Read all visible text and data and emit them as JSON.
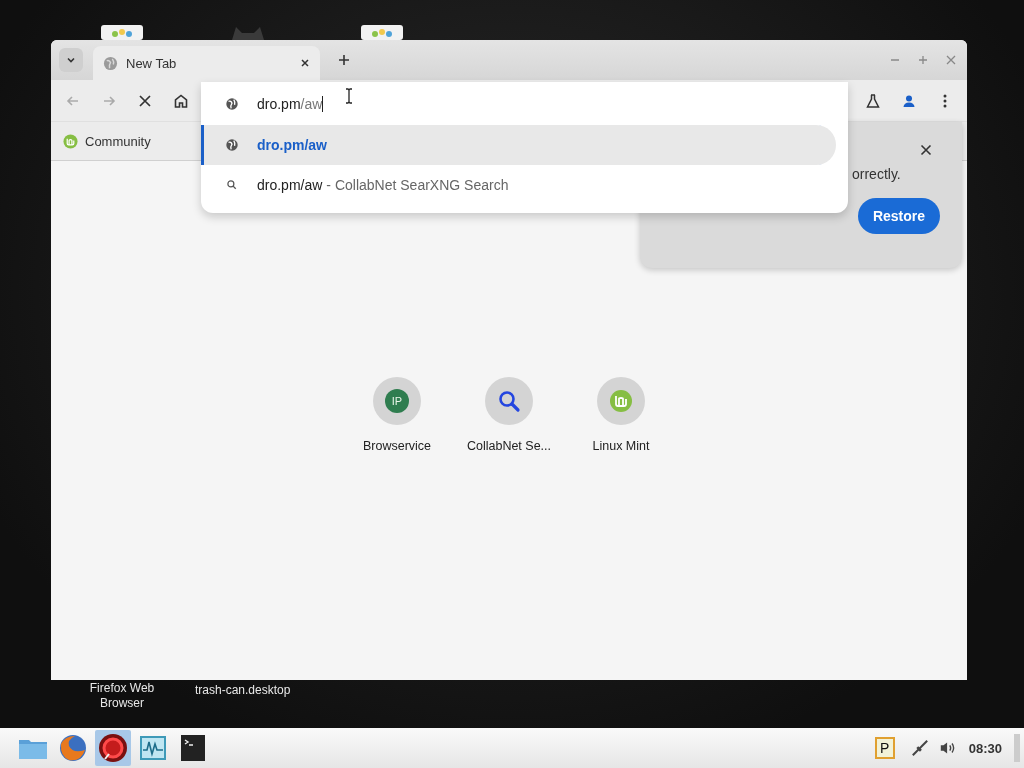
{
  "desktop": {
    "labels": [
      {
        "text": "Firefox Web Browser"
      },
      {
        "text": "trash-can.desktop"
      }
    ]
  },
  "browser": {
    "tabs": [
      {
        "title": "New Tab",
        "selected": true
      }
    ],
    "bookmarks": [
      {
        "label": "Community"
      }
    ],
    "omnibox": {
      "host": "dro.pm",
      "path": "/aw",
      "suggestions": [
        {
          "kind": "url",
          "text": "dro.pm/aw",
          "selected": true
        },
        {
          "kind": "search",
          "text": "dro.pm/aw",
          "suffix": "- CollabNet SearXNG Search",
          "selected": false
        }
      ]
    },
    "shortcuts": [
      {
        "kind": "badge",
        "badge": "IP",
        "label": "Browservice"
      },
      {
        "kind": "search",
        "label": "CollabNet Se..."
      },
      {
        "kind": "mint",
        "label": "Linux Mint"
      }
    ],
    "notice": {
      "text": "orrectly.",
      "button": "Restore"
    }
  },
  "taskbar": {
    "launchers": [
      {
        "kind": "folder",
        "active": false
      },
      {
        "kind": "firefox",
        "active": false
      },
      {
        "kind": "ring",
        "active": true
      },
      {
        "kind": "monitor",
        "active": false
      },
      {
        "kind": "terminal",
        "active": false
      }
    ],
    "tray": {
      "clipboard": "P",
      "clock": "08:30"
    }
  }
}
